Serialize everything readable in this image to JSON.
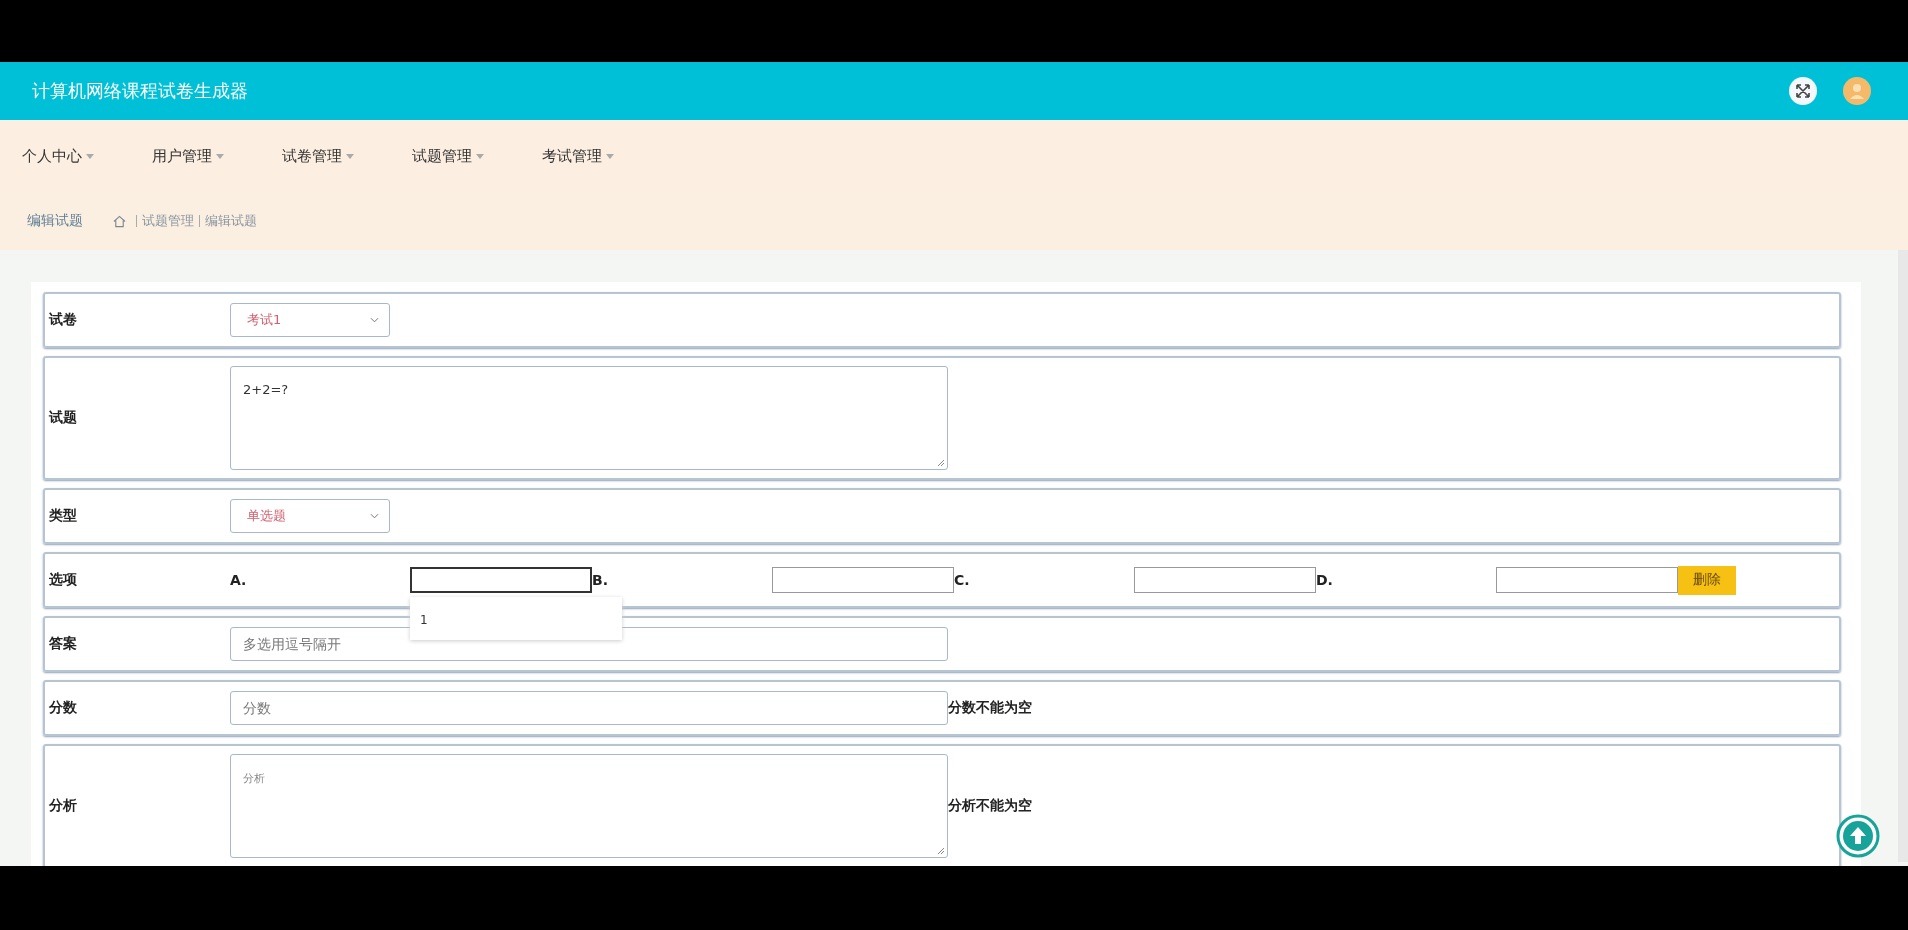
{
  "header": {
    "title": "计算机网络课程试卷生成器"
  },
  "nav": [
    {
      "label": "个人中心"
    },
    {
      "label": "用户管理"
    },
    {
      "label": "试卷管理"
    },
    {
      "label": "试题管理"
    },
    {
      "label": "考试管理"
    }
  ],
  "breadcrumb": {
    "page_title": "编辑试题",
    "path": [
      "试题管理",
      "编辑试题"
    ]
  },
  "form": {
    "rows": [
      {
        "kind": "select",
        "label": "试卷",
        "value": "考试1"
      },
      {
        "kind": "textarea",
        "label": "试题",
        "value": "2+2=?"
      },
      {
        "kind": "select",
        "label": "类型",
        "value": "单选题"
      },
      {
        "kind": "options",
        "label": "选项",
        "options": [
          {
            "letter": "A.",
            "focused": true
          },
          {
            "letter": "B.",
            "focused": false
          },
          {
            "letter": "C.",
            "focused": false
          },
          {
            "letter": "D.",
            "focused": false
          }
        ],
        "suggestions": [
          "1"
        ],
        "delete_button": "删除"
      },
      {
        "kind": "input",
        "label": "答案",
        "placeholder": "多选用逗号隔开"
      },
      {
        "kind": "input",
        "label": "分数",
        "placeholder": "分数",
        "error": "分数不能为空"
      },
      {
        "kind": "textarea",
        "label": "分析",
        "placeholder": "分析",
        "error": "分析不能为空"
      }
    ]
  }
}
